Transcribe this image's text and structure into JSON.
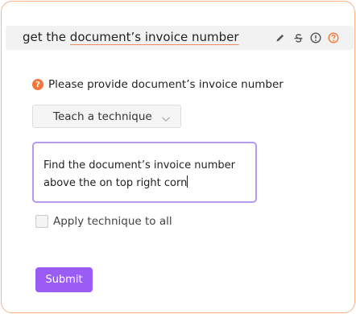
{
  "header": {
    "title_prefix": "get the ",
    "title_underlined": "document’s invoice number",
    "icons": [
      "pencil-icon",
      "strikethrough-icon",
      "info-icon",
      "help-icon"
    ]
  },
  "prompt": {
    "badge": "?",
    "text": "Please provide document’s invoice number"
  },
  "select": {
    "value": "Teach a technique"
  },
  "textarea": {
    "line1": "Find the document’s invoice number",
    "line2": "above the on top right corn"
  },
  "checkbox": {
    "label": "Apply technique to all",
    "checked": false
  },
  "submit": {
    "label": "Submit"
  },
  "colors": {
    "accent": "#9b5cf6",
    "panel_border": "#f6b58b",
    "badge": "#f3773a",
    "focus_border": "#b69af0"
  }
}
